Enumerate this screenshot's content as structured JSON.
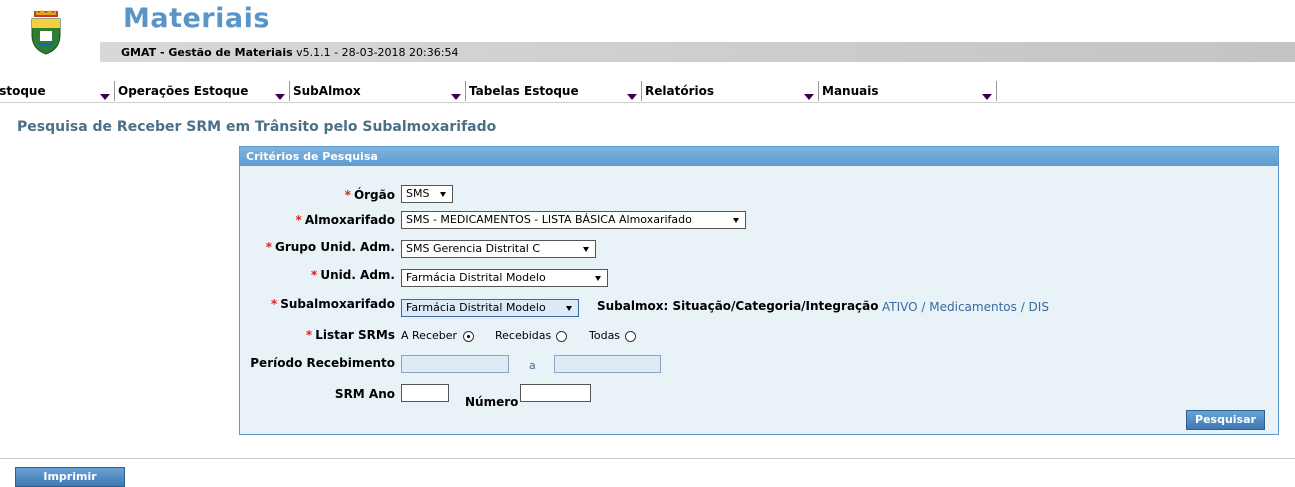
{
  "header": {
    "app_title": "Materiais",
    "system_name": "GMAT - Gestão de Materiais",
    "version_info": "v5.1.1 - 28-03-2018 20:36:54"
  },
  "menu": {
    "items": [
      {
        "label": "Estoque"
      },
      {
        "label": "Operações Estoque"
      },
      {
        "label": "SubAlmox"
      },
      {
        "label": "Tabelas Estoque"
      },
      {
        "label": "Relatórios"
      },
      {
        "label": "Manuais"
      }
    ]
  },
  "page": {
    "title": "Pesquisa de Receber SRM em Trânsito pelo Subalmoxarifado"
  },
  "panel": {
    "title": "Critérios de Pesquisa",
    "required_mark": "*",
    "orgao": {
      "label": "Órgão",
      "value": "SMS"
    },
    "almoxarifado": {
      "label": "Almoxarifado",
      "value": "SMS - MEDICAMENTOS - LISTA BÁSICA Almoxarifado"
    },
    "grupo_unid": {
      "label": "Grupo Unid. Adm.",
      "value": "SMS Gerencia Distrital C"
    },
    "unid_adm": {
      "label": "Unid. Adm.",
      "value": "Farmácia Distrital Modelo"
    },
    "subalmoxarifado": {
      "label": "Subalmoxarifado",
      "value": "Farmácia Distrital Modelo",
      "info_label": "Subalmox: Situação/Categoria/Integração",
      "info_value": "ATIVO / Medicamentos / DIS"
    },
    "listar": {
      "label": "Listar SRMs",
      "options": [
        {
          "label": "A Receber",
          "selected": true
        },
        {
          "label": "Recebidas",
          "selected": false
        },
        {
          "label": "Todas",
          "selected": false
        }
      ]
    },
    "periodo": {
      "label": "Período Recebimento",
      "separator": "a",
      "start": "",
      "end": ""
    },
    "srm": {
      "ano_label": "SRM Ano",
      "numero_label": "Número",
      "ano": "",
      "numero": ""
    },
    "search_button": "Pesquisar"
  },
  "footer": {
    "print_button": "Imprimir"
  }
}
